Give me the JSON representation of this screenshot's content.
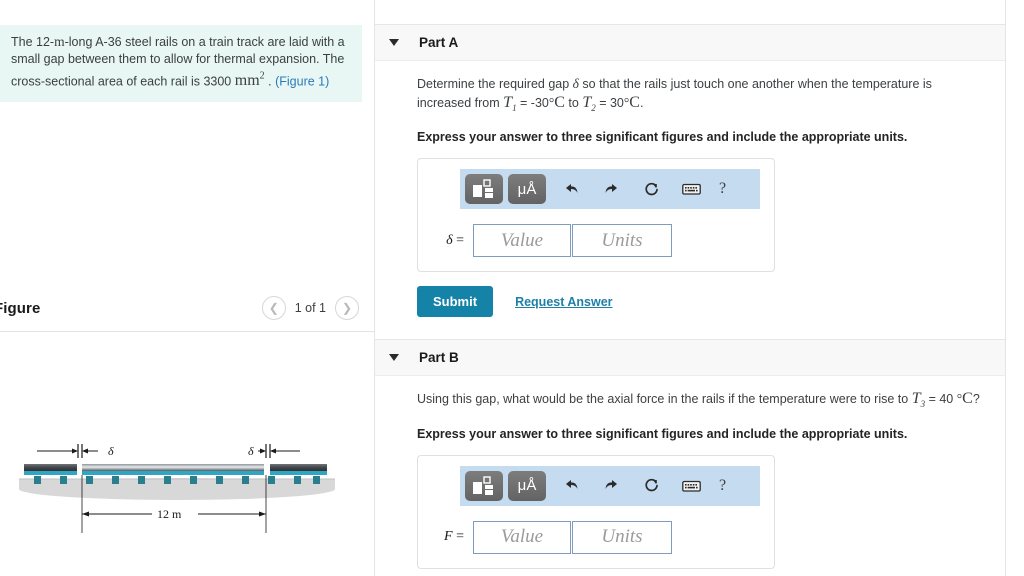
{
  "problem": {
    "text_part1": "The 12-",
    "unit_m": "m",
    "text_part2": "-long A-36 steel rails on a train track are laid with a small gap between them to allow for thermal expansion. The cross-sectional area of each rail is 3300",
    "unit_mm": "mm",
    "unit_mm_exp": "2",
    "period": ".",
    "figure_link": "(Figure 1)"
  },
  "figure_panel": {
    "title": "Figure",
    "prev_icon": "chevron-left-icon",
    "next_icon": "chevron-right-icon",
    "counter": "1 of 1",
    "diagram": {
      "gap_label_left": "δ",
      "gap_label_right": "δ",
      "span_label": "12 m"
    }
  },
  "parts": [
    {
      "id": "part-a",
      "label": "Part A",
      "caret_icon": "caret-down-icon",
      "question_segments": {
        "seg1": "Determine the required gap ",
        "delta": "δ",
        "seg2": " so that the rails just touch one another when the temperature is increased from ",
        "t1": "T",
        "t1_sub": "1",
        "t1_val": " = -30",
        "deg1": "°",
        "c1": "C",
        "seg3": "  to ",
        "t2": "T",
        "t2_sub": "2",
        "t2_val": " = 30",
        "deg2": "°",
        "c2": "C",
        "seg4": "."
      },
      "instruction": "Express your answer to three significant figures and include the appropriate units.",
      "toolbar": {
        "template_icon": "math-template-icon",
        "units_icon": "micro-angstrom-units-icon",
        "units_label": "μÅ",
        "undo_icon": "undo-arrow-icon",
        "redo_icon": "redo-arrow-icon",
        "reset_icon": "reset-circle-icon",
        "keyboard_icon": "keyboard-icon",
        "help_icon": "help-question-icon",
        "help_label": "?"
      },
      "answer": {
        "variable": "δ",
        "equals": " =",
        "value_placeholder": "Value",
        "units_placeholder": "Units"
      },
      "submit_label": "Submit",
      "request_answer_label": "Request Answer",
      "has_submit": true
    },
    {
      "id": "part-b",
      "label": "Part B",
      "caret_icon": "caret-down-icon",
      "question_segments": {
        "seg1": "Using this gap, what would be the axial force in the rails if the temperature were to rise to ",
        "t3": "T",
        "t3_sub": "3",
        "t3_val": " = 40 ",
        "deg3": "°",
        "c3": "C",
        "seg2": "?"
      },
      "instruction": "Express your answer to three significant figures and include the appropriate units.",
      "toolbar": {
        "template_icon": "math-template-icon",
        "units_icon": "micro-angstrom-units-icon",
        "units_label": "μÅ",
        "undo_icon": "undo-arrow-icon",
        "redo_icon": "redo-arrow-icon",
        "reset_icon": "reset-circle-icon",
        "keyboard_icon": "keyboard-icon",
        "help_icon": "help-question-icon",
        "help_label": "?"
      },
      "answer": {
        "variable": "F",
        "equals": " =",
        "value_placeholder": "Value",
        "units_placeholder": "Units"
      },
      "has_submit": false
    }
  ],
  "colors": {
    "problem_bg": "#e8f6f4",
    "toolbar_bg": "#c5dcf0",
    "submit_bg": "#1583a8",
    "link": "#1e7fa6",
    "part_header_bg": "#f8f8f8"
  }
}
